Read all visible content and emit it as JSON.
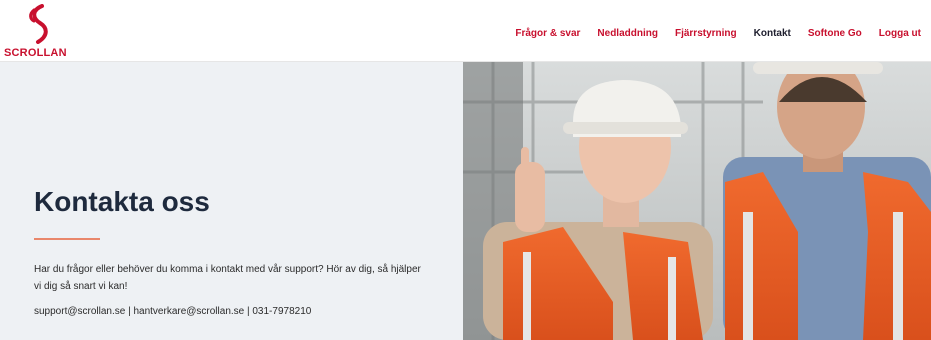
{
  "header": {
    "logo_text": "SCROLLAN",
    "nav": [
      {
        "label": "Frågor & svar",
        "active": false
      },
      {
        "label": "Nedladdning",
        "active": false
      },
      {
        "label": "Fjärrstyrning",
        "active": false
      },
      {
        "label": "Kontakt",
        "active": true
      },
      {
        "label": "Softone Go",
        "active": false
      },
      {
        "label": "Logga ut",
        "active": false
      }
    ]
  },
  "hero": {
    "title": "Kontakta oss",
    "description": "Har du frågor eller behöver du komma i kontakt med vår support? Hör av dig, så hjälper vi dig så snart vi kan!",
    "contact_line": "support@scrollan.se | hantverkare@scrollan.se | 031-7978210"
  },
  "colors": {
    "brand_red": "#c8102e",
    "accent_orange": "#e9876b",
    "title_navy": "#1e2a3d",
    "hero_bg": "#eef1f4"
  }
}
